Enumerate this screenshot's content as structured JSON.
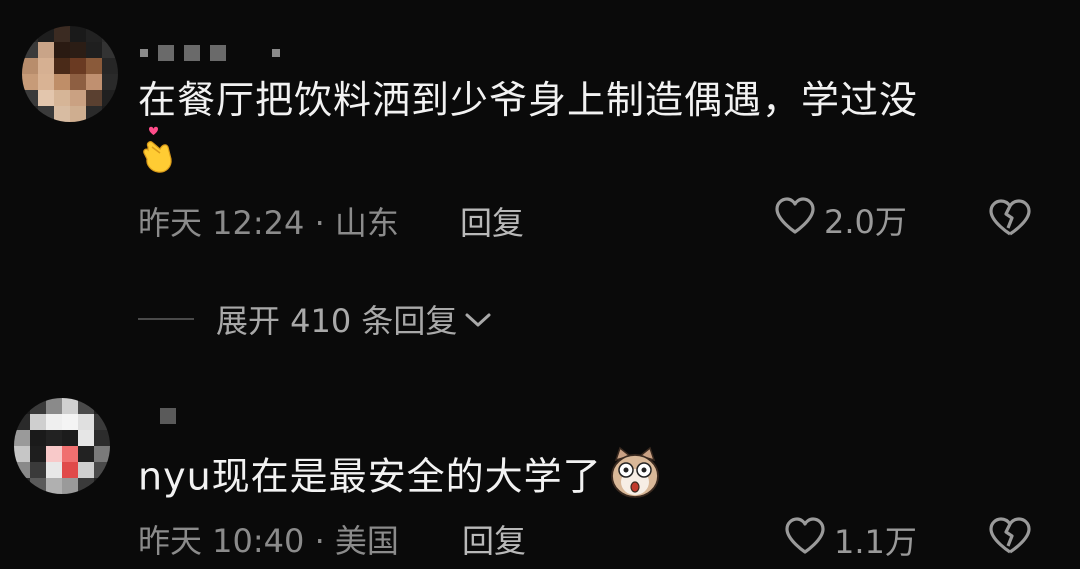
{
  "comments": [
    {
      "text": "在餐厅把饮料洒到少爷身上制造偶遇，学过没",
      "emoji": "heart-hand-emoji",
      "time": "昨天 12:24",
      "location": "山东",
      "reply_label": "回复",
      "likes": "2.0万"
    },
    {
      "text": "nyu现在是最安全的大学了",
      "emoji": "shocked-cat-emoji",
      "time": "昨天 10:40",
      "location": "美国",
      "reply_label": "回复",
      "likes": "1.1万"
    }
  ],
  "expand_replies": {
    "label": "展开 410 条回复"
  },
  "colors": {
    "background": "#0a0a0a",
    "text": "#f2f2f2",
    "meta": "#8b8b8b"
  }
}
